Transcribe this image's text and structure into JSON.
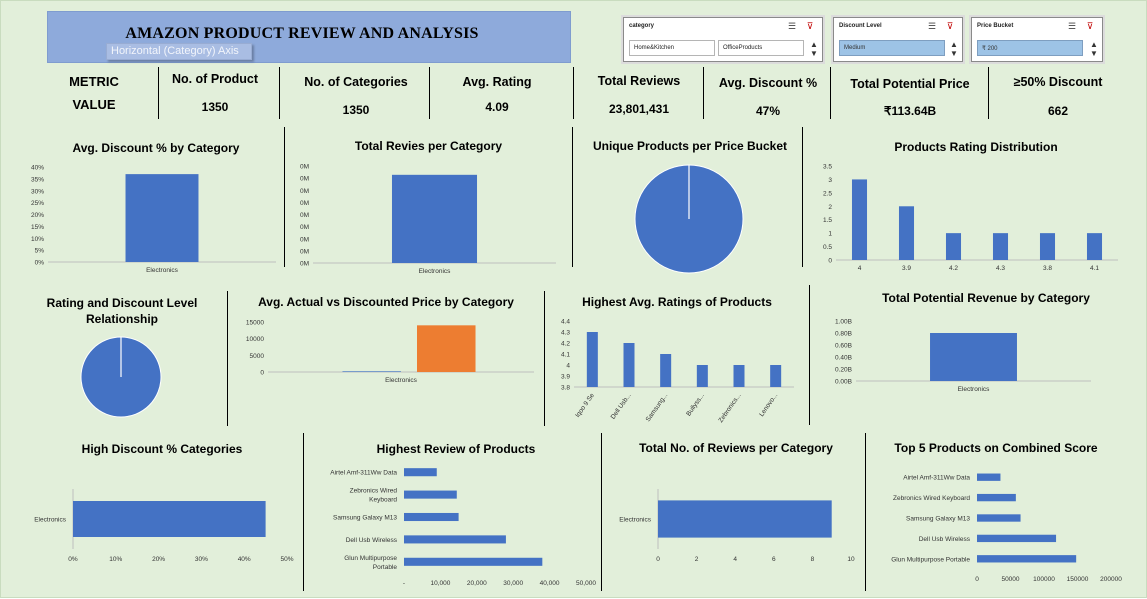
{
  "header": {
    "title": "AMAZON PRODUCT REVIEW AND ANALYSIS",
    "tooltip": "Horizontal (Category) Axis"
  },
  "slicers": [
    {
      "title": "category",
      "items": [
        "Home&Kitchen",
        "OfficeProducts"
      ]
    },
    {
      "title": "Discount Level",
      "items": [
        "Medium"
      ]
    },
    {
      "title": "Price Bucket",
      "items": [
        "₹ 200"
      ]
    }
  ],
  "kpi": {
    "metric_label": "METRIC",
    "value_label": "VALUE",
    "cards": [
      {
        "label": "No. of Product",
        "value": "1350"
      },
      {
        "label": "No. of Categories",
        "value": "1350"
      },
      {
        "label": "Avg. Rating",
        "value": "4.09"
      },
      {
        "label": "Total Reviews",
        "value": "23,801,431"
      },
      {
        "label": "Avg. Discount %",
        "value": "47%"
      },
      {
        "label": "Total Potential Price",
        "value": "₹113.64B"
      },
      {
        "label": "≥50% Discount",
        "value": "662"
      }
    ]
  },
  "colors": {
    "bar": "#4472c4",
    "accent": "#ed7d31",
    "background": "#e2efda",
    "title_fill": "#8eaadb"
  },
  "chart_data": [
    {
      "id": "c1",
      "type": "bar",
      "title": "Avg. Discount % by Category",
      "categories": [
        "Electronics"
      ],
      "values": [
        37
      ],
      "y_ticks": [
        "0%",
        "5%",
        "10%",
        "15%",
        "20%",
        "25%",
        "30%",
        "35%",
        "40%"
      ],
      "ylim": [
        0,
        40
      ]
    },
    {
      "id": "c2",
      "type": "bar",
      "title": "Total Revies per Category",
      "categories": [
        "Electronics"
      ],
      "values": [
        1
      ],
      "y_ticks": [
        "0M",
        "0M",
        "0M",
        "0M",
        "0M",
        "0M",
        "0M",
        "0M",
        "0M"
      ],
      "ylim": [
        0,
        1.1
      ]
    },
    {
      "id": "c3",
      "type": "pie",
      "title": "Unique Products per Price Bucket",
      "values": [
        1
      ]
    },
    {
      "id": "c4",
      "type": "bar",
      "title": "Products Rating Distribution",
      "categories": [
        "4",
        "3.9",
        "4.2",
        "4.3",
        "3.8",
        "4.1"
      ],
      "values": [
        3,
        2,
        1,
        1,
        1,
        1
      ],
      "y_ticks": [
        "0",
        "0.5",
        "1",
        "1.5",
        "2",
        "2.5",
        "3",
        "3.5"
      ],
      "ylim": [
        0,
        3.5
      ]
    },
    {
      "id": "c5",
      "type": "pie",
      "title": "Rating and Discount Level Relationship",
      "values": [
        1
      ]
    },
    {
      "id": "c6",
      "type": "bar",
      "title": "Avg. Actual vs Discounted Price by Category",
      "categories": [
        "Electronics"
      ],
      "series": [
        {
          "values": [
            200
          ]
        },
        {
          "values": [
            14000
          ]
        }
      ],
      "y_ticks": [
        "0",
        "5000",
        "10000",
        "15000"
      ],
      "ylim": [
        0,
        15000
      ]
    },
    {
      "id": "c7",
      "type": "bar",
      "title": "Highest Avg. Ratings of Products",
      "categories": [
        "Iqoo 9 Se",
        "Dell Usb...",
        "Samsung...",
        "Bullyss...",
        "Zebronics...",
        "Lenovo..."
      ],
      "values": [
        4.3,
        4.2,
        4.1,
        4.0,
        4.0,
        4.0
      ],
      "y_ticks": [
        "3.8",
        "3.9",
        "4",
        "4.1",
        "4.2",
        "4.3",
        "4.4"
      ],
      "ylim": [
        3.8,
        4.4
      ]
    },
    {
      "id": "c8",
      "type": "bar",
      "title": "Total Potential Revenue by Category",
      "categories": [
        "Electronics"
      ],
      "values": [
        0.8
      ],
      "y_ticks": [
        "0.00B",
        "0.20B",
        "0.40B",
        "0.60B",
        "0.80B",
        "1.00B"
      ],
      "ylim": [
        0,
        1.0
      ]
    },
    {
      "id": "c9",
      "type": "bar-horizontal",
      "title": "High Discount % Categories",
      "categories": [
        "Electronics"
      ],
      "values": [
        45
      ],
      "x_ticks": [
        "0%",
        "10%",
        "20%",
        "30%",
        "40%",
        "50%"
      ],
      "xlim": [
        0,
        50
      ]
    },
    {
      "id": "c10",
      "type": "bar-horizontal",
      "title": "Highest Review of Products",
      "categories": [
        "Airtel Amf-311Ww Data",
        "Zebronics Wired Keyboard",
        "Samsung Galaxy M13",
        "Dell Usb Wireless",
        "Glun Multipurpose Portable"
      ],
      "values": [
        9000,
        14500,
        15000,
        28000,
        38000
      ],
      "x_ticks": [
        "-",
        "10,000",
        "20,000",
        "30,000",
        "40,000",
        "50,000"
      ],
      "xlim": [
        0,
        50000
      ]
    },
    {
      "id": "c11",
      "type": "bar-horizontal",
      "title": "Total No. of Reviews per Category",
      "categories": [
        "Electronics"
      ],
      "values": [
        9
      ],
      "x_ticks": [
        "0",
        "2",
        "4",
        "6",
        "8",
        "10"
      ],
      "xlim": [
        0,
        10
      ]
    },
    {
      "id": "c12",
      "type": "bar-horizontal",
      "title": "Top 5 Products on Combined Score",
      "categories": [
        "Airtel Amf-311Ww Data",
        "Zebronics Wired Keyboard",
        "Samsung Galaxy M13",
        "Dell Usb Wireless",
        "Glun Multipurpose Portable"
      ],
      "values": [
        35000,
        58000,
        65000,
        118000,
        148000
      ],
      "x_ticks": [
        "0",
        "50000",
        "100000",
        "150000",
        "200000"
      ],
      "xlim": [
        0,
        200000
      ]
    }
  ]
}
